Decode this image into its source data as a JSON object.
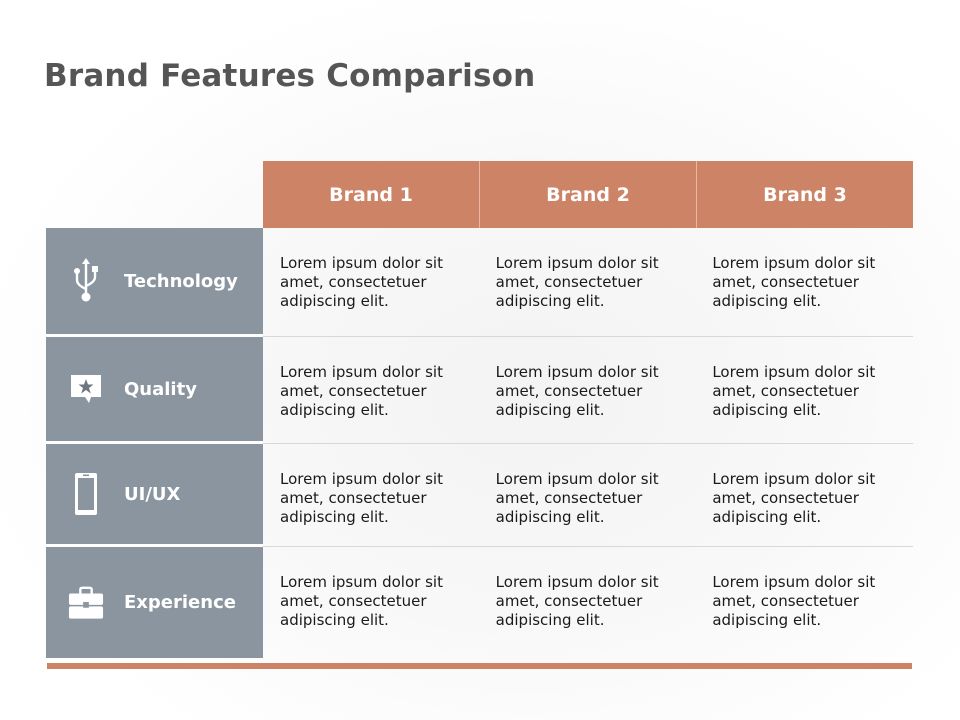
{
  "title": "Brand Features Comparison",
  "colors": {
    "header": "#cd8466",
    "row_label": "#8a959f",
    "title_text": "#555555",
    "footer_bar": "#cd8466"
  },
  "table": {
    "columns": [
      "Brand 1",
      "Brand 2",
      "Brand 3"
    ],
    "rows": [
      {
        "label": "Technology",
        "icon": "usb-icon",
        "cells": [
          "Lorem ipsum dolor sit amet, consectetuer adipiscing elit.",
          "Lorem ipsum dolor sit amet, consectetuer adipiscing elit.",
          "Lorem ipsum dolor sit amet, consectetuer adipiscing elit."
        ]
      },
      {
        "label": "Quality",
        "icon": "star-speech-bubble-icon",
        "cells": [
          "Lorem ipsum dolor sit amet, consectetuer adipiscing elit.",
          "Lorem ipsum dolor sit amet, consectetuer adipiscing elit.",
          "Lorem ipsum dolor sit amet, consectetuer adipiscing elit."
        ]
      },
      {
        "label": "UI/UX",
        "icon": "smartphone-icon",
        "cells": [
          "Lorem ipsum dolor sit amet, consectetuer adipiscing elit.",
          "Lorem ipsum dolor sit amet, consectetuer adipiscing elit.",
          "Lorem ipsum dolor sit amet, consectetuer adipiscing elit."
        ]
      },
      {
        "label": "Experience",
        "icon": "briefcase-icon",
        "cells": [
          "Lorem ipsum dolor sit amet, consectetuer adipiscing elit.",
          "Lorem ipsum dolor sit amet, consectetuer adipiscing elit.",
          "Lorem ipsum dolor sit amet, consectetuer adipiscing elit."
        ]
      }
    ]
  }
}
